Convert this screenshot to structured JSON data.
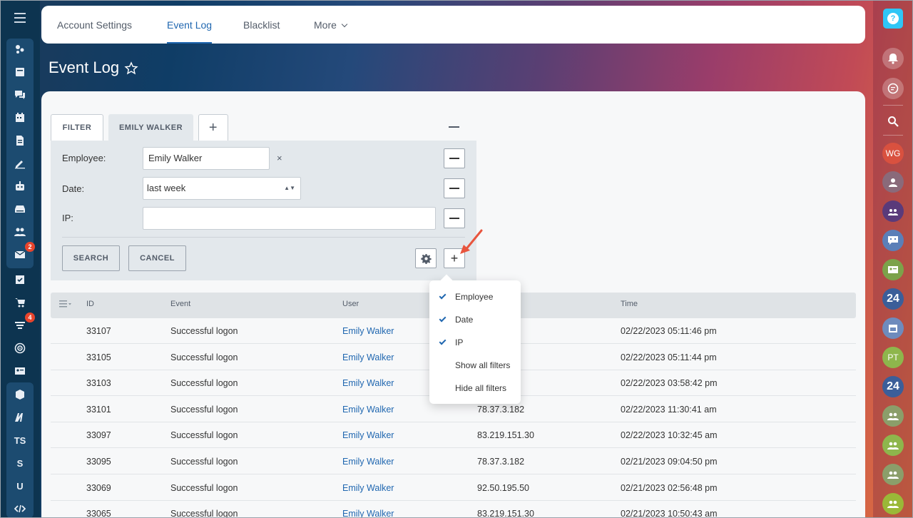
{
  "nav": {
    "tabs": [
      "Account Settings",
      "Event Log",
      "Blacklist",
      "More"
    ],
    "active": "Event Log"
  },
  "page": {
    "title": "Event Log"
  },
  "sidebar_left": {
    "badges": {
      "mail": "2",
      "funnel": "4"
    },
    "text_items": [
      "TS",
      "S",
      "U"
    ]
  },
  "sidebar_right": {
    "avatars": [
      "WG",
      "PT"
    ],
    "badge_24": "24"
  },
  "filter": {
    "tabs": [
      "FILTER",
      "EMILY WALKER"
    ],
    "fields": [
      {
        "label": "Employee:",
        "value": "Emily Walker"
      },
      {
        "label": "Date:",
        "value": "last week"
      },
      {
        "label": "IP:",
        "value": ""
      }
    ],
    "clear": "×",
    "buttons": {
      "search": "SEARCH",
      "cancel": "CANCEL"
    }
  },
  "popup": {
    "items": [
      {
        "label": "Employee",
        "checked": true
      },
      {
        "label": "Date",
        "checked": true
      },
      {
        "label": "IP",
        "checked": true
      },
      {
        "label": "Show all filters",
        "checked": false
      },
      {
        "label": "Hide all filters",
        "checked": false
      }
    ]
  },
  "table": {
    "columns": [
      "ID",
      "Event",
      "User",
      "",
      "Time"
    ],
    "rows": [
      {
        "id": "33107",
        "event": "Successful logon",
        "user": "Emily Walker",
        "ip": "...50",
        "time": "02/22/2023 05:11:46 pm"
      },
      {
        "id": "33105",
        "event": "Successful logon",
        "user": "Emily Walker",
        "ip": "...50",
        "time": "02/22/2023 05:11:44 pm"
      },
      {
        "id": "33103",
        "event": "Successful logon",
        "user": "Emily Walker",
        "ip": "...30",
        "time": "02/22/2023 03:58:42 pm"
      },
      {
        "id": "33101",
        "event": "Successful logon",
        "user": "Emily Walker",
        "ip": "78.37.3.182",
        "time": "02/22/2023 11:30:41 am"
      },
      {
        "id": "33097",
        "event": "Successful logon",
        "user": "Emily Walker",
        "ip": "83.219.151.30",
        "time": "02/22/2023 10:32:45 am"
      },
      {
        "id": "33095",
        "event": "Successful logon",
        "user": "Emily Walker",
        "ip": "78.37.3.182",
        "time": "02/21/2023 09:04:50 pm"
      },
      {
        "id": "33069",
        "event": "Successful logon",
        "user": "Emily Walker",
        "ip": "92.50.195.50",
        "time": "02/21/2023 02:56:48 pm"
      },
      {
        "id": "33065",
        "event": "Successful logon",
        "user": "Emily Walker",
        "ip": "83.219.151.30",
        "time": "02/21/2023 10:50:43 am"
      }
    ]
  },
  "colors": {
    "accent": "#2067b0",
    "badge": "#e8442c",
    "help": "#2fc6f6",
    "arrow": "#e8553e"
  }
}
